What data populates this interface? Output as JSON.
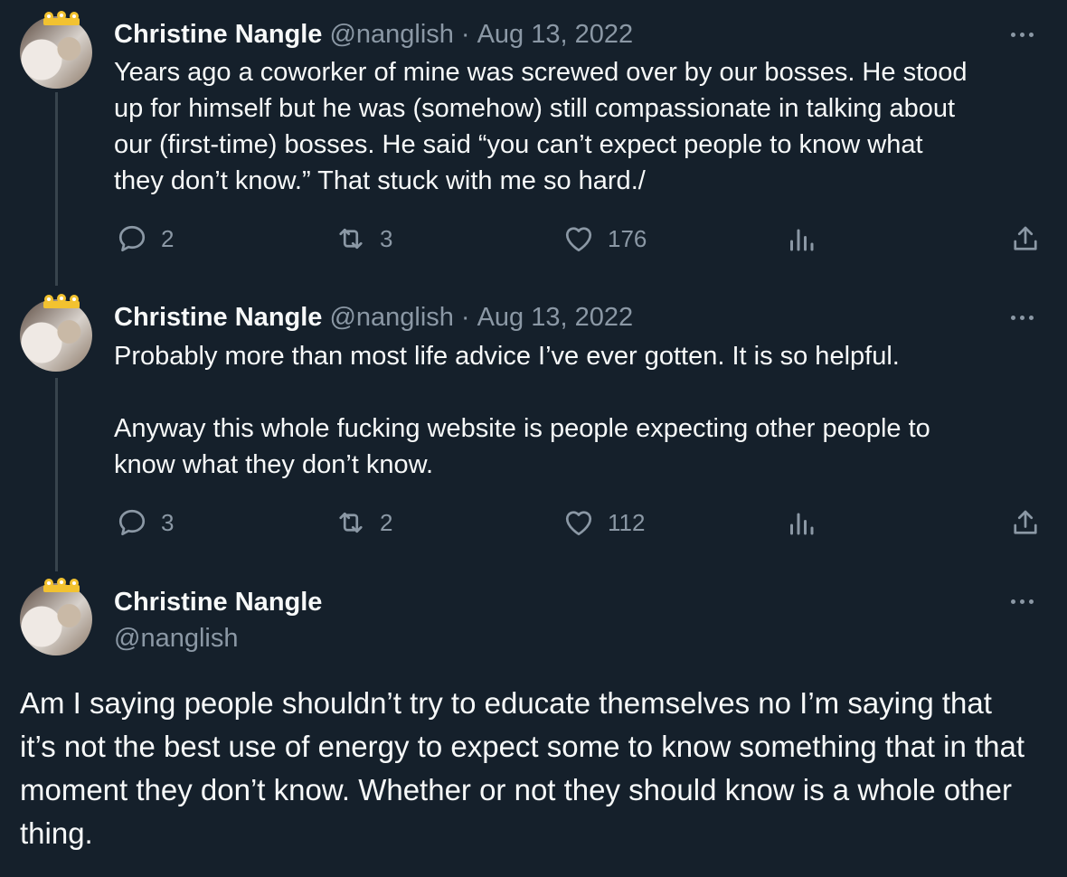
{
  "tweets": [
    {
      "name": "Christine Nangle",
      "handle": "@nanglish",
      "date": "Aug 13, 2022",
      "text": "Years ago a coworker of mine was screwed over by our bosses. He stood\nup for himself but he was (somehow) still compassionate in talking about\nour (first-time) bosses. He said “you can’t expect people to know what\nthey don’t know.” That stuck with me so hard./",
      "replies": "2",
      "retweets": "3",
      "likes": "176"
    },
    {
      "name": "Christine Nangle",
      "handle": "@nanglish",
      "date": "Aug 13, 2022",
      "text": "Probably more than most life advice I’ve ever gotten. It is so helpful.\n\nAnyway this whole fucking website is people expecting other people to\nknow what they don’t know.",
      "replies": "3",
      "retweets": "2",
      "likes": "112"
    }
  ],
  "focused": {
    "name": "Christine Nangle",
    "handle": "@nanglish",
    "text": "Am I saying people shouldn’t try to educate themselves no I’m saying that it’s not the best use of energy to expect some to know something that in that moment they don’t know. Whether or not they should know is a whole other thing."
  },
  "separator": "·",
  "colors": {
    "background": "#15202b",
    "text": "#f7f9f9",
    "muted": "#8b98a5",
    "line": "#38444d"
  },
  "icons": [
    "reply-icon",
    "retweet-icon",
    "like-icon",
    "views-icon",
    "share-icon",
    "more-icon"
  ]
}
